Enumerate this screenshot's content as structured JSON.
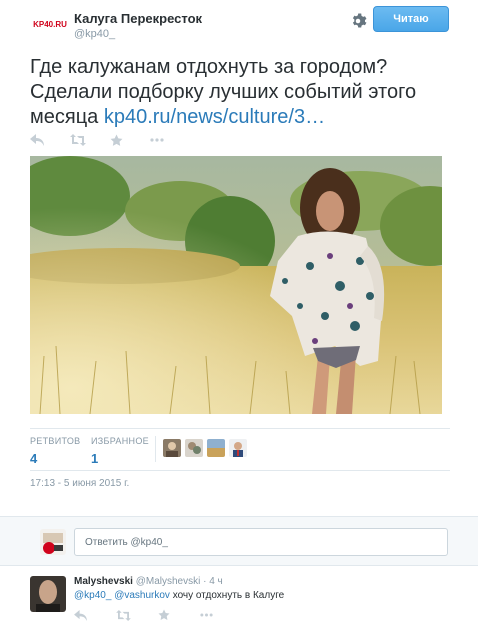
{
  "account": {
    "logo_text": "KP40.RU",
    "name": "Калуга Перекресток",
    "handle": "@kp40_",
    "follow_label": "Читаю"
  },
  "tweet": {
    "text_plain": "Где калужанам отдохнуть за городом? Сделали подборку лучших событий этого месяца ",
    "link": "kp40.ru/news/culture/3…",
    "timestamp": "17:13 - 5 июня 2015 г."
  },
  "stats": {
    "retweets_label": "РЕТВИТОВ",
    "retweets_count": "4",
    "favorites_label": "ИЗБРАННОЕ",
    "favorites_count": "1"
  },
  "reply_box": {
    "placeholder": "Ответить @kp40_"
  },
  "reply": {
    "name": "Malyshevski",
    "handle": "@Malyshevski",
    "time": "· 4 ч",
    "mention1": "@kp40_",
    "mention2": "@vashurkov",
    "text": " хочу отдохнуть в Калуге"
  },
  "icons": [
    "reply-icon",
    "retweet-icon",
    "favorite-icon",
    "more-icon",
    "gear-icon"
  ],
  "colors": {
    "link": "#2b7bb9",
    "follow_button": "#4aa6e8",
    "muted": "#8899a6"
  }
}
